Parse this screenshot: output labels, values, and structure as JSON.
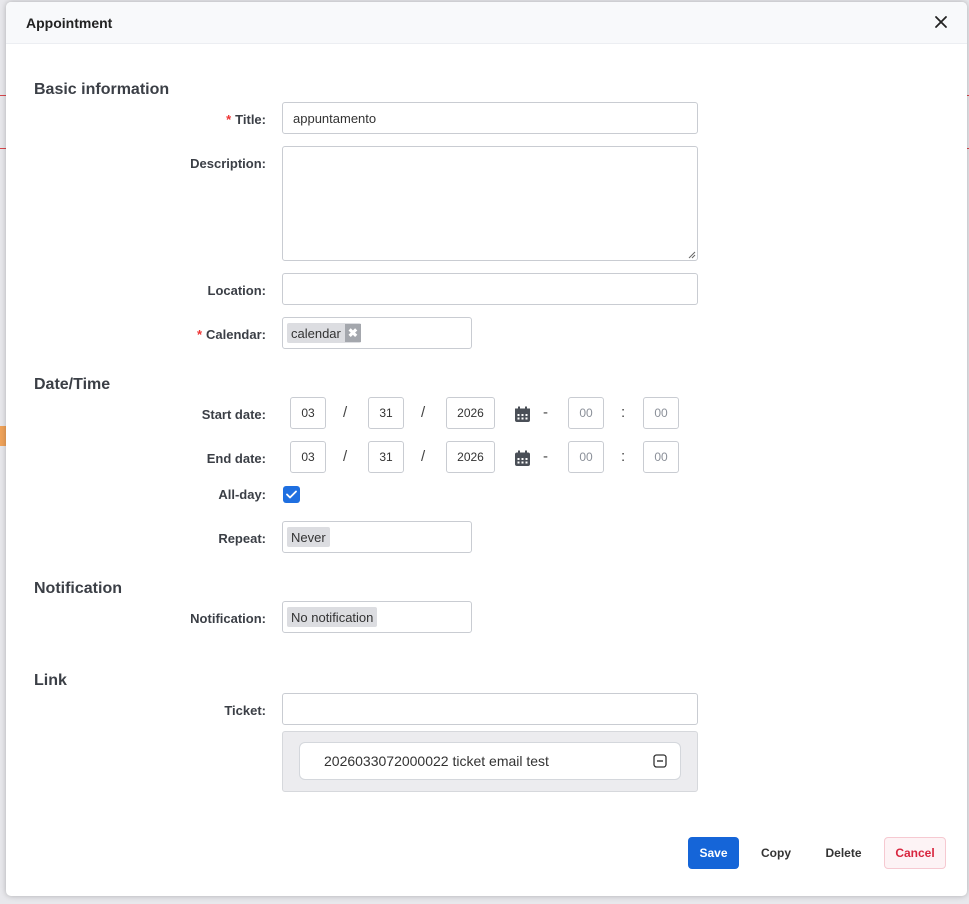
{
  "dialog": {
    "title": "Appointment"
  },
  "sections": {
    "basic": "Basic information",
    "datetime": "Date/Time",
    "notification": "Notification",
    "link": "Link"
  },
  "fields": {
    "title": {
      "label": "Title:",
      "required": "*",
      "value": "appuntamento"
    },
    "description": {
      "label": "Description:",
      "value": ""
    },
    "location": {
      "label": "Location:",
      "value": ""
    },
    "calendar": {
      "label": "Calendar:",
      "required": "*",
      "chip": "calendar"
    },
    "start_date": {
      "label": "Start date:",
      "month": "03",
      "day": "31",
      "year": "2026",
      "hour": "00",
      "minute": "00"
    },
    "end_date": {
      "label": "End date:",
      "month": "03",
      "day": "31",
      "year": "2026",
      "hour": "00",
      "minute": "00"
    },
    "all_day": {
      "label": "All-day:",
      "checked": true
    },
    "repeat": {
      "label": "Repeat:",
      "value": "Never"
    },
    "notification": {
      "label": "Notification:",
      "value": "No notification"
    },
    "ticket": {
      "label": "Ticket:",
      "value": "",
      "linked": "2026033072000022 ticket email test"
    }
  },
  "separators": {
    "date": "/",
    "range": "-",
    "time": ":"
  },
  "buttons": {
    "save": "Save",
    "copy": "Copy",
    "delete": "Delete",
    "cancel": "Cancel"
  },
  "icons": {
    "close": "close-icon",
    "calendar": "calendar-icon",
    "check": "check-icon",
    "collapse": "minus-square-icon",
    "chip_remove": "x-icon"
  },
  "colors": {
    "primary": "#1565d8",
    "required": "#e33333",
    "cancel_text": "#d8263f",
    "background_accent": "#d8484c"
  }
}
